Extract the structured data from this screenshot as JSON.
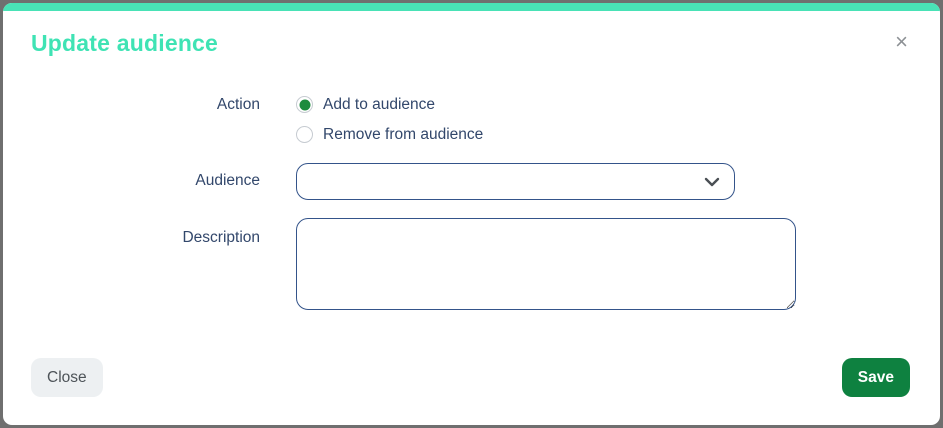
{
  "modal": {
    "title": "Update audience",
    "close_icon": "×",
    "accent_color": "#49e2b6",
    "title_color": "#3fe3b4"
  },
  "form": {
    "action": {
      "label": "Action",
      "options": [
        {
          "label": "Add to audience",
          "selected": true
        },
        {
          "label": "Remove from audience",
          "selected": false
        }
      ],
      "selected_color": "#1e8b3e"
    },
    "audience": {
      "label": "Audience",
      "value": "",
      "placeholder": ""
    },
    "description": {
      "label": "Description",
      "value": "",
      "placeholder": ""
    }
  },
  "footer": {
    "close_label": "Close",
    "save_label": "Save",
    "save_color": "#0e8140"
  }
}
